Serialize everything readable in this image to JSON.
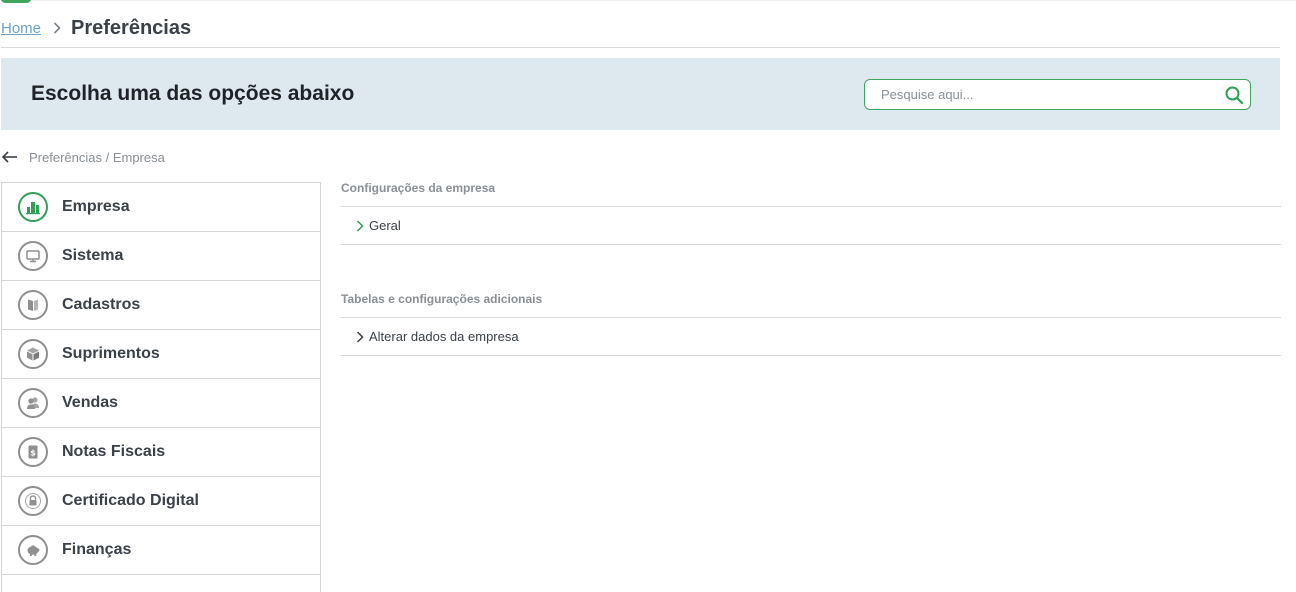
{
  "breadcrumb": {
    "home": "Home",
    "current": "Preferências"
  },
  "banner": {
    "title": "Escolha uma das opções abaixo",
    "search_placeholder": "Pesquise aqui..."
  },
  "back": {
    "path": "Preferências / Empresa"
  },
  "sidebar": {
    "items": [
      {
        "label": "Empresa",
        "icon": "building-icon",
        "active": true
      },
      {
        "label": "Sistema",
        "icon": "monitor-icon",
        "active": false
      },
      {
        "label": "Cadastros",
        "icon": "book-icon",
        "active": false
      },
      {
        "label": "Suprimentos",
        "icon": "box-icon",
        "active": false
      },
      {
        "label": "Vendas",
        "icon": "users-icon",
        "active": false
      },
      {
        "label": "Notas Fiscais",
        "icon": "invoice-icon",
        "active": false
      },
      {
        "label": "Certificado Digital",
        "icon": "lock-icon",
        "active": false
      },
      {
        "label": "Finanças",
        "icon": "piggy-bank-icon",
        "active": false
      }
    ]
  },
  "content": {
    "sections": [
      {
        "title": "Configurações da empresa",
        "options": [
          "Geral"
        ]
      },
      {
        "title": "Tabelas e configurações adicionais",
        "options": [
          "Alterar dados da empresa"
        ]
      }
    ]
  },
  "colors": {
    "accent": "#2f9e57",
    "banner_bg": "#dde8ef",
    "link": "#6aa3c9"
  }
}
